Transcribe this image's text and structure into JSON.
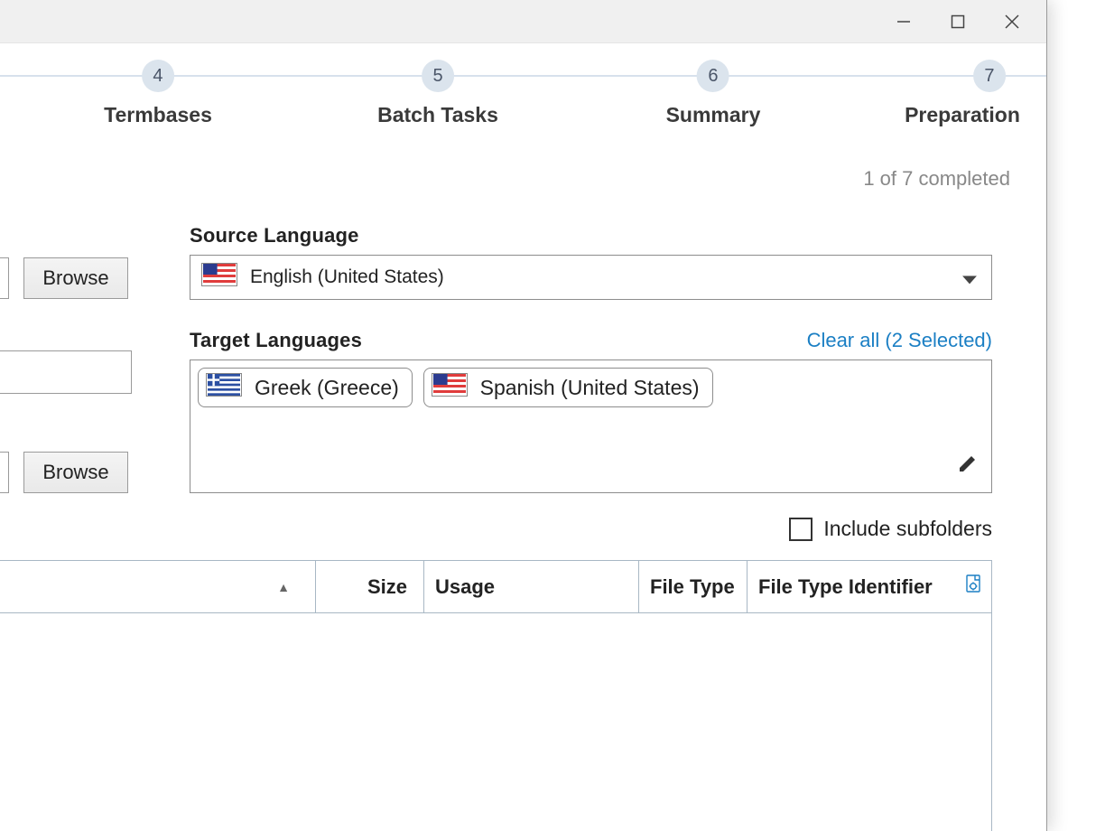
{
  "window_controls": {
    "minimize": "minimize",
    "maximize": "maximize",
    "close": "close"
  },
  "stepper": {
    "steps": [
      {
        "num": "4",
        "label": "Termbases"
      },
      {
        "num": "5",
        "label": "Batch Tasks"
      },
      {
        "num": "6",
        "label": "Summary"
      },
      {
        "num": "7",
        "label": "Preparation"
      }
    ]
  },
  "progress_text": "1 of 7 completed",
  "buttons": {
    "browse": "Browse"
  },
  "source": {
    "label": "Source Language",
    "value": "English (United States)",
    "flag": "us"
  },
  "target": {
    "label": "Target Languages",
    "clear_link": "Clear all (2 Selected)",
    "items": [
      {
        "label": "Greek (Greece)",
        "flag": "gr"
      },
      {
        "label": "Spanish (United States)",
        "flag": "us"
      }
    ]
  },
  "subfolders_label": "Include subfolders",
  "table": {
    "columns": {
      "name": "",
      "size": "Size",
      "usage": "Usage",
      "file_type": "File Type",
      "identifier": "File Type Identifier"
    }
  }
}
